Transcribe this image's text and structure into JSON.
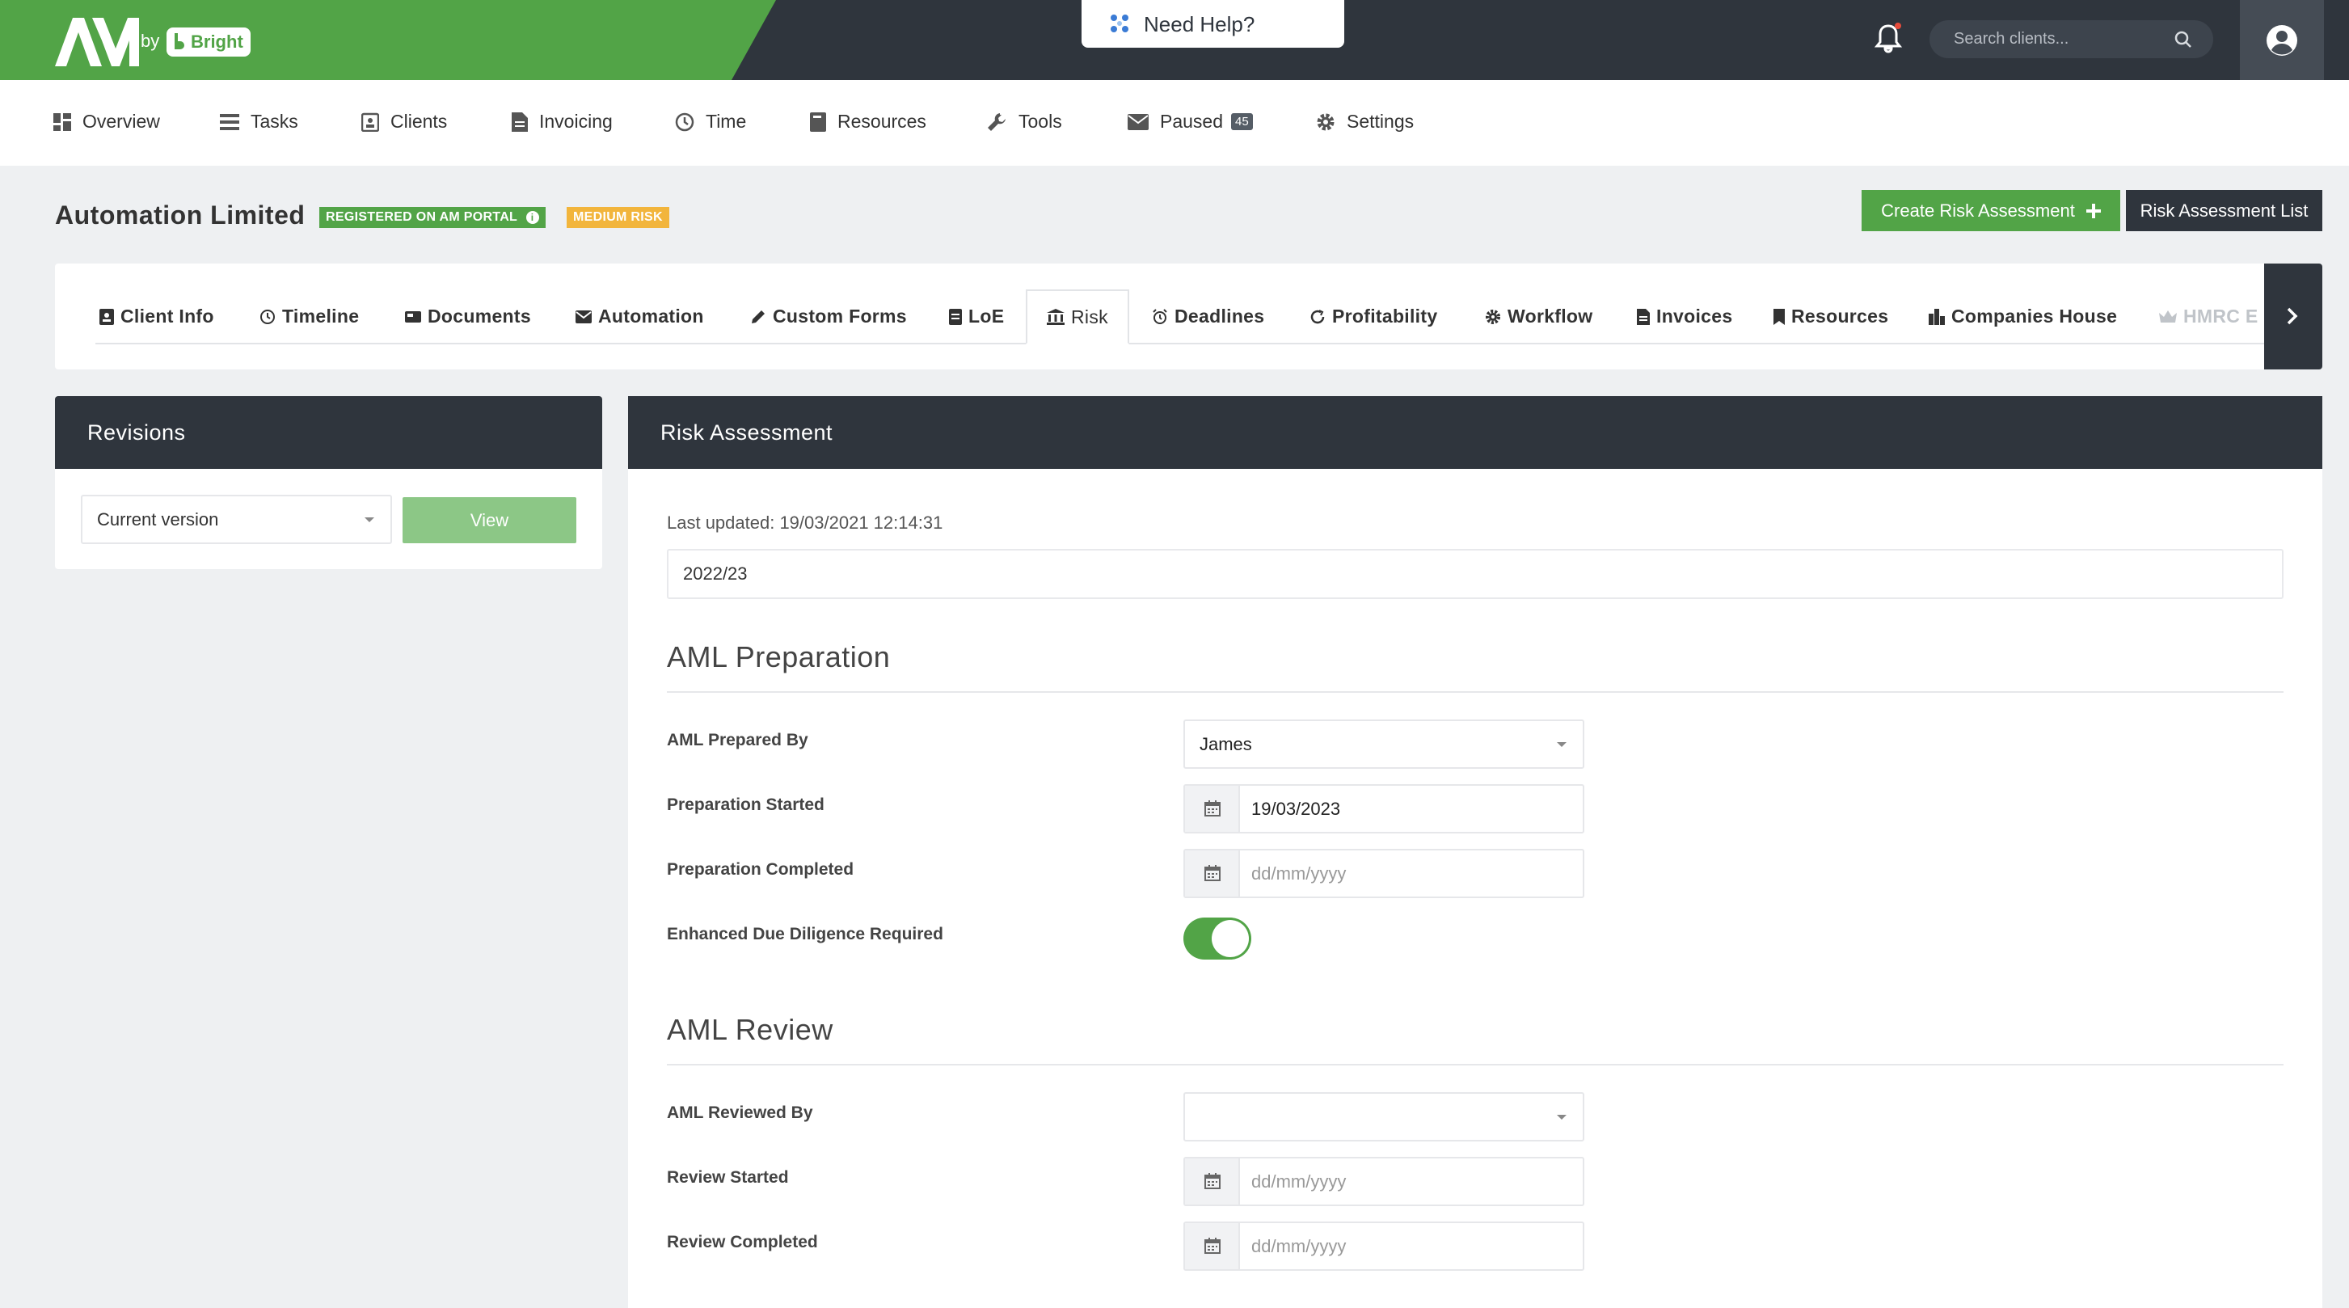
{
  "brand": {
    "by": "by",
    "name": "Bright"
  },
  "help": {
    "label": "Need Help?"
  },
  "search": {
    "placeholder": "Search clients..."
  },
  "nav": [
    {
      "label": "Overview",
      "icon": "grid-icon"
    },
    {
      "label": "Tasks",
      "icon": "tasks-icon"
    },
    {
      "label": "Clients",
      "icon": "clients-icon"
    },
    {
      "label": "Invoicing",
      "icon": "document-icon"
    },
    {
      "label": "Time",
      "icon": "clock-icon"
    },
    {
      "label": "Resources",
      "icon": "book-icon"
    },
    {
      "label": "Tools",
      "icon": "wrench-icon"
    },
    {
      "label": "Paused",
      "icon": "envelope-icon",
      "count": "45"
    },
    {
      "label": "Settings",
      "icon": "gear-icon"
    }
  ],
  "client": {
    "name": "Automation Limited",
    "portal_tag": "REGISTERED ON AM PORTAL",
    "risk_tag": "MEDIUM RISK",
    "create_button": "Create Risk Assessment",
    "list_button": "Risk Assessment List"
  },
  "tabs": [
    {
      "label": "Client Info"
    },
    {
      "label": "Timeline"
    },
    {
      "label": "Documents"
    },
    {
      "label": "Automation"
    },
    {
      "label": "Custom Forms"
    },
    {
      "label": "LoE"
    },
    {
      "label": "Risk"
    },
    {
      "label": "Deadlines"
    },
    {
      "label": "Profitability"
    },
    {
      "label": "Workflow"
    },
    {
      "label": "Invoices"
    },
    {
      "label": "Resources"
    },
    {
      "label": "Companies House"
    },
    {
      "label": "HMRC E"
    }
  ],
  "revisions": {
    "title": "Revisions",
    "selected": "Current version",
    "view_button": "View"
  },
  "risk": {
    "title": "Risk Assessment",
    "last_updated": "Last updated: 19/03/2021 12:14:31",
    "year": "2022/23",
    "preparation": {
      "title": "AML Preparation",
      "prepared_by_label": "AML Prepared By",
      "prepared_by_value": "James",
      "started_label": "Preparation Started",
      "started_value": "19/03/2023",
      "completed_label": "Preparation Completed",
      "completed_placeholder": "dd/mm/yyyy",
      "edd_label": "Enhanced Due Diligence Required",
      "edd_on": true
    },
    "review": {
      "title": "AML Review",
      "reviewed_by_label": "AML Reviewed By",
      "reviewed_by_value": "",
      "started_label": "Review Started",
      "started_placeholder": "dd/mm/yyyy",
      "completed_label": "Review Completed",
      "completed_placeholder": "dd/mm/yyyy"
    }
  },
  "colors": {
    "brand_green": "#52a447",
    "dark": "#2f353d",
    "warning": "#f2b53c"
  }
}
